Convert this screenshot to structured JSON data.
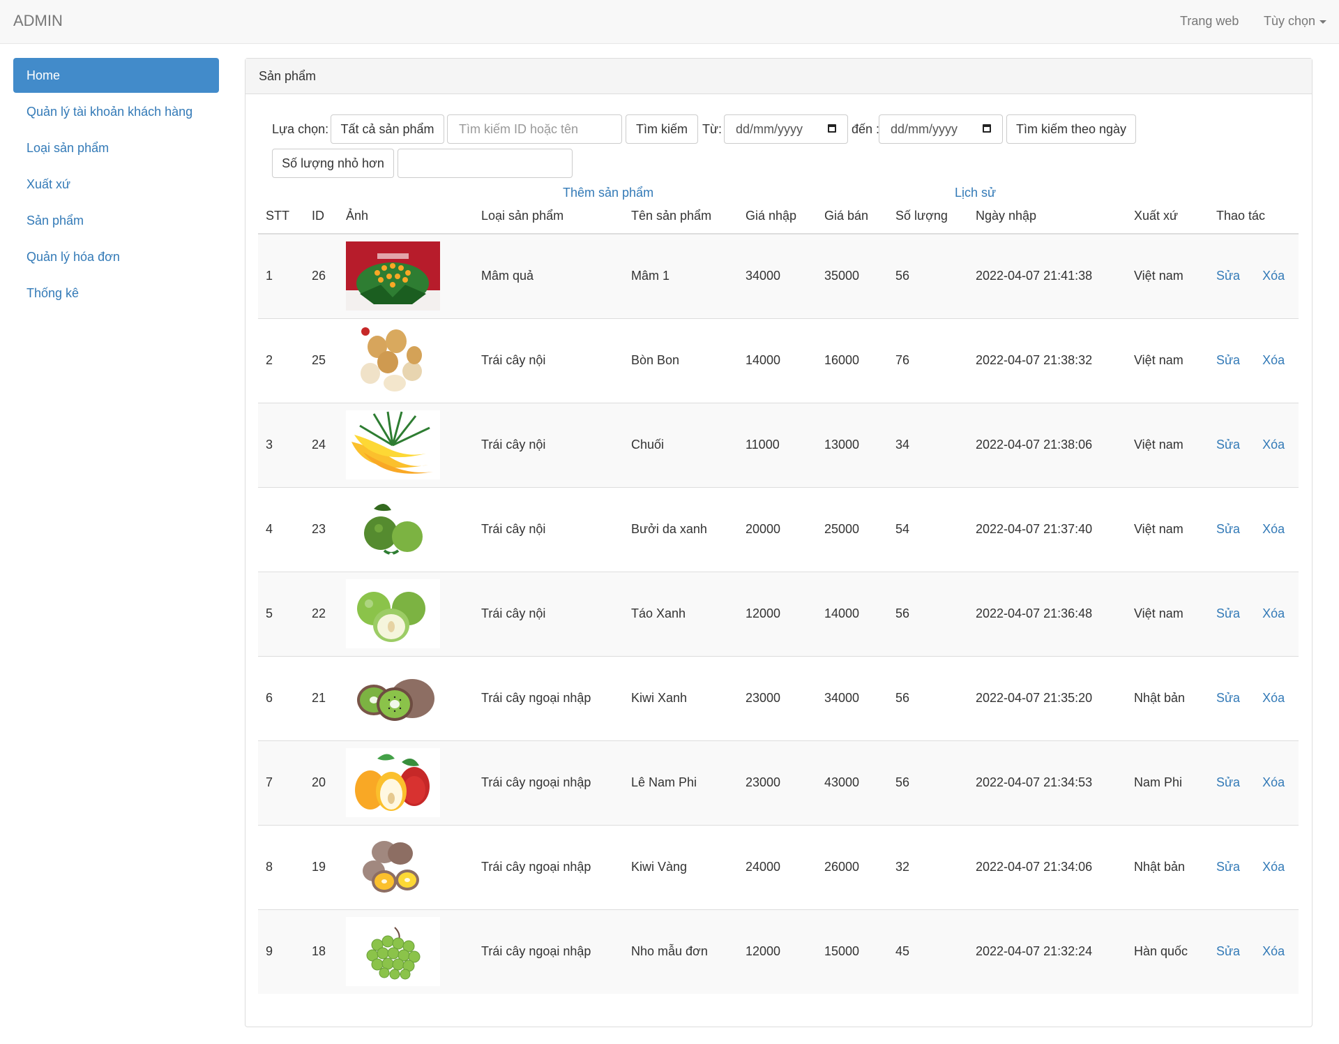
{
  "navbar": {
    "brand": "ADMIN",
    "links": [
      "Trang web",
      "Tùy chọn"
    ]
  },
  "sidebar": {
    "items": [
      {
        "label": "Home",
        "active": true
      },
      {
        "label": "Quản lý tài khoản khách hàng"
      },
      {
        "label": "Loại sản phẩm"
      },
      {
        "label": "Xuất xứ"
      },
      {
        "label": "Sản phẩm"
      },
      {
        "label": "Quản lý hóa đơn"
      },
      {
        "label": "Thống kê"
      }
    ]
  },
  "panel": {
    "title": "Sản phẩm"
  },
  "filters": {
    "label": "Lựa chọn:",
    "all_products": "Tất cả sản phẩm",
    "search_placeholder": "Tìm kiếm ID hoặc tên",
    "search_button": "Tìm kiếm",
    "from_label": "Từ:",
    "date_placeholder": "dd/mm/yyyy",
    "to_label": "đến :",
    "search_by_date": "Tìm kiếm theo ngày",
    "quantity_less": "Số lượng nhỏ hơn",
    "quantity_value": ""
  },
  "links": {
    "add_product": "Thêm sản phẩm",
    "history": "Lịch sử"
  },
  "table": {
    "headers": [
      "STT",
      "ID",
      "Ảnh",
      "Loại sản phẩm",
      "Tên sản phẩm",
      "Giá nhập",
      "Giá bán",
      "Số lượng",
      "Ngày nhập",
      "Xuất xứ",
      "Thao tác"
    ],
    "edit_label": "Sửa",
    "delete_label": "Xóa",
    "rows": [
      {
        "stt": "1",
        "id": "26",
        "image": "fruit-tray-image",
        "category": "Mâm quả",
        "name": "Mâm 1",
        "cost": "34000",
        "price": "35000",
        "qty": "56",
        "date": "2022-04-07 21:41:38",
        "origin": "Việt nam"
      },
      {
        "stt": "2",
        "id": "25",
        "image": "bon-bon-image",
        "category": "Trái cây nội",
        "name": "Bòn Bon",
        "cost": "14000",
        "price": "16000",
        "qty": "76",
        "date": "2022-04-07 21:38:32",
        "origin": "Việt nam"
      },
      {
        "stt": "3",
        "id": "24",
        "image": "banana-image",
        "category": "Trái cây nội",
        "name": "Chuối",
        "cost": "11000",
        "price": "13000",
        "qty": "34",
        "date": "2022-04-07 21:38:06",
        "origin": "Việt nam"
      },
      {
        "stt": "4",
        "id": "23",
        "image": "pomelo-image",
        "category": "Trái cây nội",
        "name": "Bưởi da xanh",
        "cost": "20000",
        "price": "25000",
        "qty": "54",
        "date": "2022-04-07 21:37:40",
        "origin": "Việt nam"
      },
      {
        "stt": "5",
        "id": "22",
        "image": "green-apple-image",
        "category": "Trái cây nội",
        "name": "Táo Xanh",
        "cost": "12000",
        "price": "14000",
        "qty": "56",
        "date": "2022-04-07 21:36:48",
        "origin": "Việt nam"
      },
      {
        "stt": "6",
        "id": "21",
        "image": "green-kiwi-image",
        "category": "Trái cây ngoại nhập",
        "name": "Kiwi Xanh",
        "cost": "23000",
        "price": "34000",
        "qty": "56",
        "date": "2022-04-07 21:35:20",
        "origin": "Nhật bản"
      },
      {
        "stt": "7",
        "id": "20",
        "image": "pear-image",
        "category": "Trái cây ngoại nhập",
        "name": "Lê Nam Phi",
        "cost": "23000",
        "price": "43000",
        "qty": "56",
        "date": "2022-04-07 21:34:53",
        "origin": "Nam Phi"
      },
      {
        "stt": "8",
        "id": "19",
        "image": "golden-kiwi-image",
        "category": "Trái cây ngoại nhập",
        "name": "Kiwi Vàng",
        "cost": "24000",
        "price": "26000",
        "qty": "32",
        "date": "2022-04-07 21:34:06",
        "origin": "Nhật bản"
      },
      {
        "stt": "9",
        "id": "18",
        "image": "grape-image",
        "category": "Trái cây ngoại nhập",
        "name": "Nho mẫu đơn",
        "cost": "12000",
        "price": "15000",
        "qty": "45",
        "date": "2022-04-07 21:32:24",
        "origin": "Hàn quốc"
      }
    ]
  }
}
